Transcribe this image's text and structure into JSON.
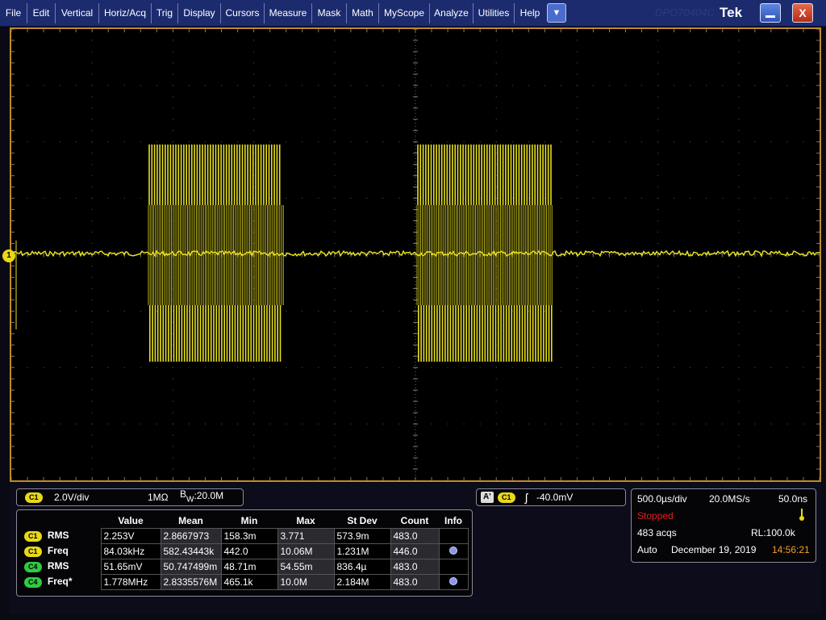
{
  "menu": {
    "items": [
      "File",
      "Edit",
      "Vertical",
      "Horiz/Acq",
      "Trig",
      "Display",
      "Cursors",
      "Measure",
      "Mask",
      "Math",
      "MyScope",
      "Analyze",
      "Utilities",
      "Help"
    ],
    "dropdown_glyph": "▼",
    "brand_ghost": "DPO70404C",
    "brand": "Tek",
    "close_glyph": "X"
  },
  "waveform": {
    "channel_marker": "1",
    "color": "#e8e020"
  },
  "channel_panel": {
    "badge": "C1",
    "scale": "2.0V/div",
    "impedance": "1MΩ",
    "bw_prefix": "B",
    "bw_sub": "W",
    "bw_value": ":20.0M"
  },
  "trigger_panel": {
    "mode_badge": "A'",
    "badge": "C1",
    "slope_glyph": "ʃ",
    "level": "-40.0mV"
  },
  "acq_panel": {
    "time_div": "500.0µs/div",
    "sample_rate": "20.0MS/s",
    "resolution": "50.0ns",
    "state": "Stopped",
    "acqs": "483 acqs",
    "record_length": "RL:100.0k",
    "trigger_mode": "Auto",
    "date": "December 19, 2019",
    "time": "14:56:21"
  },
  "measurements": {
    "headers": [
      "",
      "Value",
      "Mean",
      "Min",
      "Max",
      "St Dev",
      "Count",
      "Info"
    ],
    "rows": [
      {
        "channel": "C1",
        "name": "RMS",
        "value": "2.253V",
        "mean": "2.8667973",
        "min": "158.3m",
        "max": "3.771",
        "stdev": "573.9m",
        "count": "483.0",
        "info": false
      },
      {
        "channel": "C1",
        "name": "Freq",
        "value": "84.03kHz",
        "mean": "582.43443k",
        "min": "442.0",
        "max": "10.06M",
        "stdev": "1.231M",
        "count": "446.0",
        "info": true
      },
      {
        "channel": "C4",
        "name": "RMS",
        "value": "51.65mV",
        "mean": "50.747499m",
        "min": "48.71m",
        "max": "54.55m",
        "stdev": "836.4µ",
        "count": "483.0",
        "info": false
      },
      {
        "channel": "C4",
        "name": "Freq*",
        "value": "1.778MHz",
        "mean": "2.8335576M",
        "min": "465.1k",
        "max": "10.0M",
        "stdev": "2.184M",
        "count": "483.0",
        "info": true
      }
    ]
  },
  "colors": {
    "c1": "#e8d818",
    "c4": "#2ecc40",
    "frame": "#c08a28",
    "menubar": "#1c2b6e"
  }
}
